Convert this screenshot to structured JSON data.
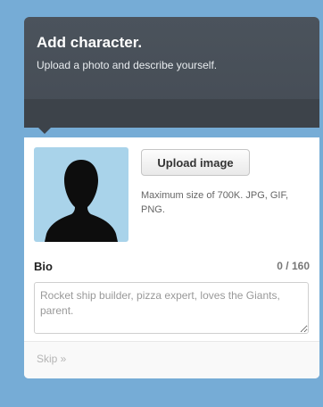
{
  "header": {
    "title": "Add character.",
    "subtitle": "Upload a photo and describe yourself."
  },
  "photo": {
    "upload_label": "Upload image",
    "note": "Maximum size of 700K. JPG, GIF, PNG."
  },
  "bio": {
    "label": "Bio",
    "counter": "0 / 160",
    "placeholder": "Rocket ship builder, pizza expert, loves the Giants, parent."
  },
  "footer": {
    "skip_label": "Skip »"
  },
  "colors": {
    "page_background": "#76acd6",
    "header_background": "#454c55",
    "avatar_background": "#a9d3ea"
  },
  "icons": {
    "avatar": "default-silhouette-avatar"
  }
}
